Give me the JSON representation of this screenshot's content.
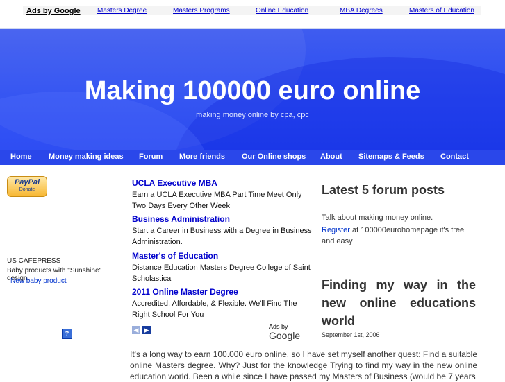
{
  "topbar": {
    "ads_by": "Ads by Google",
    "links": [
      "Masters Degree",
      "Masters Programs",
      "Online Education",
      "MBA Degrees",
      "Masters of Education"
    ]
  },
  "header": {
    "title": "Making 100000 euro online",
    "subtitle": "making money online by cpa, cpc"
  },
  "nav": {
    "items": [
      "Home",
      "Money making ideas",
      "Forum",
      "More friends",
      "Our Online shops",
      "About",
      "Sitemaps & Feeds",
      "Contact"
    ]
  },
  "sidebar": {
    "paypal_brand": "PayPal",
    "paypal_label": "Donate",
    "shop_title": "US CAFEPRESS",
    "shop_desc": "Baby products with \"Sunshine\" design.",
    "shop_link": "New baby product"
  },
  "ads": {
    "items": [
      {
        "title": "UCLA Executive MBA",
        "desc": "Earn a UCLA Executive MBA Part Time Meet Only Two Days Every Other Week"
      },
      {
        "title": "Business Administration",
        "desc": "Start a Career in Business with a Degree in Business Administration."
      },
      {
        "title": "Master's of Education",
        "desc": "Distance Education Masters Degree College of Saint Scholastica"
      },
      {
        "title": "2011 Online Master Degree",
        "desc": "Accredited, Affordable, & Flexible. We'll Find The Right School For You"
      }
    ],
    "ads_by": "Ads by",
    "google": "Google"
  },
  "forum": {
    "heading": "Latest 5 forum posts",
    "line1": "Talk about making money online.",
    "register": "Register",
    "line2": " at 100000eurohomepage it's free and easy"
  },
  "post": {
    "title": "Finding my way in the new online educations world",
    "date": "September 1st, 2006",
    "body": "It's a long way to earn 100.000 euro online, so I have set myself another quest: Find a suitable online Masters degree. Why? Just for the knowledge Trying to find my way in the new online education world. Been a while since I have passed my Masters of Business (would be 7 years"
  },
  "colors": {
    "header_blue": "#2a4cf2",
    "nav_blue": "#2a47ea",
    "link_blue": "#0000cc"
  }
}
